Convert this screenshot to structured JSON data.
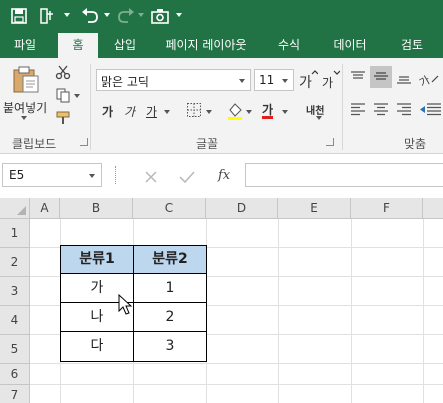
{
  "ribbon_tabs": [
    "파일",
    "홈",
    "삽입",
    "페이지 레이아웃",
    "수식",
    "데이터",
    "검토"
  ],
  "active_tab": "홈",
  "clipboard": {
    "paste_label": "붙여넣기",
    "group_label": "클립보드"
  },
  "font": {
    "name": "맑은 고딕",
    "size": "11",
    "group_label": "글꼴",
    "bold": "가",
    "italic": "가",
    "underline": "가",
    "font_color_glyph": "가",
    "font_color": "#e02020",
    "phonetic_label": "내천"
  },
  "alignment": {
    "group_label": "맞춤"
  },
  "formula_bar": {
    "name_box": "E5",
    "fx_label": "fx",
    "formula": ""
  },
  "columns": [
    "A",
    "B",
    "C",
    "D",
    "E",
    "F"
  ],
  "rows": [
    "1",
    "2",
    "3",
    "4",
    "5",
    "6",
    "7"
  ],
  "table": {
    "headers": [
      "분류1",
      "분류2"
    ],
    "rows": [
      [
        "가",
        "1"
      ],
      [
        "나",
        "2"
      ],
      [
        "다",
        "3"
      ]
    ]
  },
  "colors": {
    "brand": "#217346",
    "header_fill": "#bdd7ee"
  }
}
